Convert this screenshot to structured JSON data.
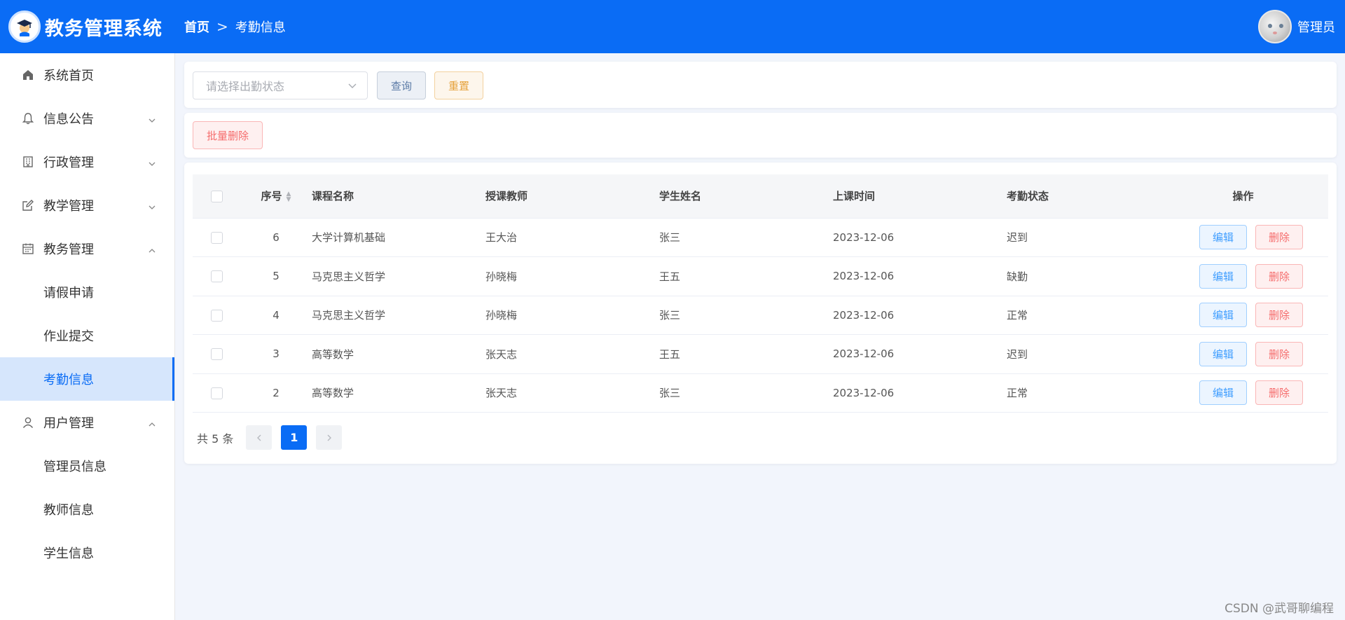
{
  "header": {
    "app_title": "教务管理系统",
    "breadcrumb_home": "首页",
    "breadcrumb_separator": ">",
    "breadcrumb_current": "考勤信息",
    "user_name": "管理员",
    "brand_color": "#0a6cf5"
  },
  "sidebar": {
    "items": [
      {
        "label": "系统首页",
        "icon": "home-icon"
      },
      {
        "label": "信息公告",
        "icon": "bell-icon"
      },
      {
        "label": "行政管理",
        "icon": "building-icon"
      },
      {
        "label": "教学管理",
        "icon": "edit-icon"
      },
      {
        "label": "教务管理",
        "icon": "calendar-icon"
      },
      {
        "label": "请假申请"
      },
      {
        "label": "作业提交"
      },
      {
        "label": "考勤信息",
        "active": true
      },
      {
        "label": "用户管理",
        "icon": "user-icon"
      },
      {
        "label": "管理员信息"
      },
      {
        "label": "教师信息"
      },
      {
        "label": "学生信息"
      }
    ]
  },
  "search": {
    "status_placeholder": "请选择出勤状态",
    "query_label": "查询",
    "reset_label": "重置"
  },
  "toolbar": {
    "batch_delete_label": "批量删除"
  },
  "table": {
    "columns": [
      "序号",
      "课程名称",
      "授课教师",
      "学生姓名",
      "上课时间",
      "考勤状态",
      "操作"
    ],
    "rows": [
      {
        "id": "6",
        "course": "大学计算机基础",
        "teacher": "王大治",
        "student": "张三",
        "time": "2023-12-06",
        "status": "迟到"
      },
      {
        "id": "5",
        "course": "马克思主义哲学",
        "teacher": "孙晓梅",
        "student": "王五",
        "time": "2023-12-06",
        "status": "缺勤"
      },
      {
        "id": "4",
        "course": "马克思主义哲学",
        "teacher": "孙晓梅",
        "student": "张三",
        "time": "2023-12-06",
        "status": "正常"
      },
      {
        "id": "3",
        "course": "高等数学",
        "teacher": "张天志",
        "student": "王五",
        "time": "2023-12-06",
        "status": "迟到"
      },
      {
        "id": "2",
        "course": "高等数学",
        "teacher": "张天志",
        "student": "张三",
        "time": "2023-12-06",
        "status": "正常"
      }
    ],
    "edit_label": "编辑",
    "delete_label": "删除"
  },
  "pagination": {
    "total_text": "共 5 条",
    "current_page": "1",
    "prev_icon": "chevron-left-icon",
    "next_icon": "chevron-right-icon"
  },
  "watermark": "CSDN @武哥聊编程"
}
